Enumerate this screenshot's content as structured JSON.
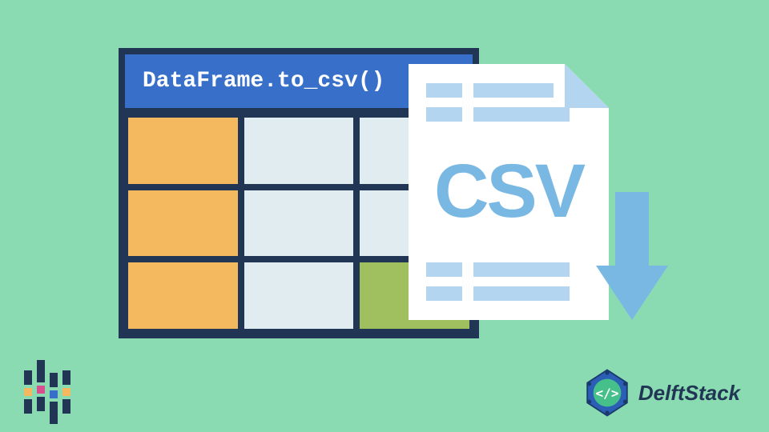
{
  "header": {
    "title": "DataFrame.to_csv()"
  },
  "grid": {
    "cells": [
      {
        "color": "orange"
      },
      {
        "color": "light"
      },
      {
        "color": "light"
      },
      {
        "color": "orange"
      },
      {
        "color": "light"
      },
      {
        "color": "light"
      },
      {
        "color": "orange"
      },
      {
        "color": "light"
      },
      {
        "color": "green"
      }
    ]
  },
  "file": {
    "label": "CSV"
  },
  "brand": {
    "name": "DelftStack"
  }
}
